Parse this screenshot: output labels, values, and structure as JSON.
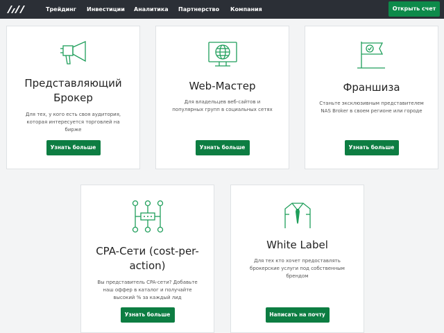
{
  "header": {
    "nav": [
      "Трейдинг",
      "Инвестиции",
      "Аналитика",
      "Партнерство",
      "Компания"
    ],
    "cta": "Открыть счет"
  },
  "cards": [
    {
      "icon": "megaphone-icon",
      "title_line1": "Представляющий",
      "title_line2": "Брокер",
      "desc": [
        "Для тех, у кого есть своя аудитория,",
        "которая интересуется торговлей на",
        "бирже"
      ],
      "button": "Узнать больше"
    },
    {
      "icon": "globe-monitor-icon",
      "title_line1": "Web-Мастер",
      "title_line2": "",
      "desc": [
        "Для владельцев веб-сайтов и",
        "популярных групп в социальных сетях"
      ],
      "button": "Узнать больше"
    },
    {
      "icon": "flag-icon",
      "title_line1": "Франшиза",
      "title_line2": "",
      "desc": [
        "Станьте эксклюзивным представителем",
        "NAS Broker в своем регионе или городе"
      ],
      "button": "Узнать больше"
    },
    {
      "icon": "network-icon",
      "title_line1": "CPA-Сети (cost-per-",
      "title_line2": "action)",
      "desc": [
        "Вы представитель CPA-сети? Добавьте",
        "наш оффер в каталог и получайте",
        "высокий % за каждый лид"
      ],
      "button": "Узнать больше"
    },
    {
      "icon": "suit-tie-icon",
      "title_line1": "White Label",
      "title_line2": "",
      "desc": [
        "Для тех кто хочет предоставлять",
        "брокерские услуги под собственным",
        "брендом"
      ],
      "button": "Написать на почту"
    }
  ],
  "colors": {
    "header_bg": "#2b2f36",
    "accent": "#0d7d42",
    "icon_green": "#1e9e5a"
  }
}
